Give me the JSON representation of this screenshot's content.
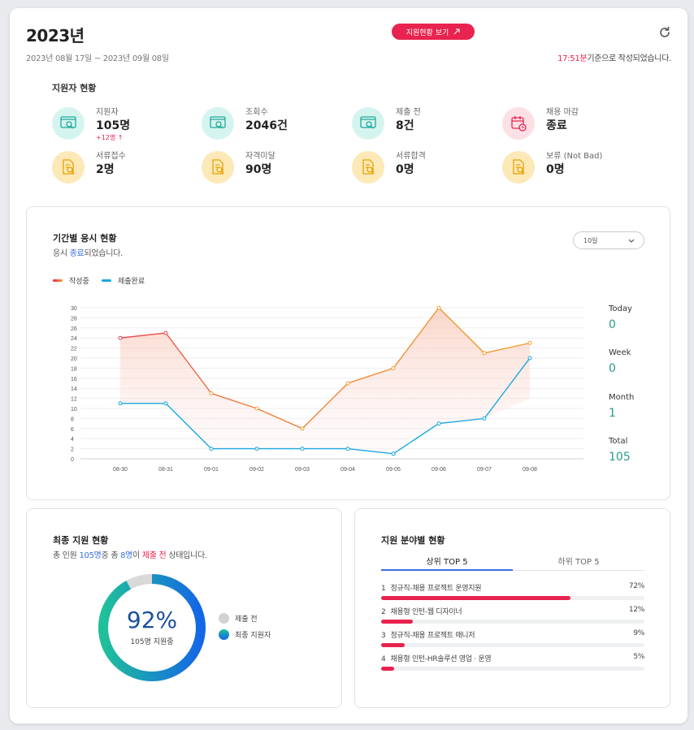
{
  "header": {
    "title": "2023년",
    "date_range": "2023년 08월 17일 ~ 2023년 09월 08일",
    "view_button": "지원현황 보기",
    "stamp_time": "17:51분",
    "stamp_suffix": "기준으로 작성되었습니다."
  },
  "applicants": {
    "section_title": "지원자 현황",
    "stats": [
      {
        "label": "지원자",
        "value": "105명",
        "delta": "+12명 ↑",
        "icon": "monitor-search-icon",
        "color": "teal"
      },
      {
        "label": "조회수",
        "value": "2046건",
        "icon": "monitor-search-icon",
        "color": "teal"
      },
      {
        "label": "제출 전",
        "value": "8건",
        "icon": "monitor-search-icon",
        "color": "teal"
      },
      {
        "label": "채용 마감",
        "value": "종료",
        "icon": "calendar-clock-icon",
        "color": "pink"
      },
      {
        "label": "서류접수",
        "value": "2명",
        "icon": "document-search-icon",
        "color": "yellow"
      },
      {
        "label": "자격미달",
        "value": "90명",
        "icon": "document-search-icon",
        "color": "yellow"
      },
      {
        "label": "서류합격",
        "value": "0명",
        "icon": "document-search-icon",
        "color": "yellow"
      },
      {
        "label": "보류 (Not Bad)",
        "value": "0명",
        "icon": "document-search-icon",
        "color": "yellow"
      }
    ]
  },
  "period": {
    "title": "기간별 응시 현황",
    "sub_prefix": "응시 ",
    "sub_highlight": "종료",
    "sub_suffix": "되었습니다.",
    "select_value": "10일",
    "side_stats": [
      {
        "label": "Today",
        "value": "0"
      },
      {
        "label": "Week",
        "value": "0"
      },
      {
        "label": "Month",
        "value": "1"
      },
      {
        "label": "Total",
        "value": "105"
      }
    ]
  },
  "chart_data": {
    "type": "line",
    "x": [
      "08-30",
      "08-31",
      "09-01",
      "09-02",
      "09-03",
      "09-04",
      "09-05",
      "09-06",
      "09-07",
      "09-08"
    ],
    "series": [
      {
        "name": "작성중",
        "values": [
          24,
          25,
          13,
          10,
          6,
          15,
          18,
          30,
          21,
          23
        ],
        "color": "#f0a030"
      },
      {
        "name": "제출완료",
        "values": [
          11,
          11,
          2,
          2,
          2,
          2,
          1,
          7,
          8,
          20
        ],
        "color": "#1aa7e0"
      }
    ],
    "yticks": [
      0,
      2,
      4,
      6,
      8,
      10,
      12,
      14,
      16,
      18,
      20,
      22,
      24,
      26,
      28,
      30
    ],
    "ylim": [
      0,
      30
    ],
    "grid": true,
    "legend": "top-left"
  },
  "final": {
    "title": "최종 지원 현황",
    "s1": "총 인원 ",
    "s2": "105명",
    "s3": "중 총 ",
    "s4": "8명",
    "s5": "이 ",
    "s6": "제출 전",
    "s7": " 상태입니다.",
    "percent": "92%",
    "center_sub": "105명 지원중",
    "ratio": 0.92,
    "legend_before": "제출 전",
    "legend_final": "최종 지원자"
  },
  "field": {
    "title": "지원 분야별 현황",
    "tab_top": "상위 TOP 5",
    "tab_bottom": "하위 TOP 5",
    "items": [
      {
        "rank": "1",
        "name": "정규직-채용 프로젝트 운영지원",
        "percent": "72%",
        "value": 72
      },
      {
        "rank": "2",
        "name": "채용형 인턴-웹 디자이너",
        "percent": "12%",
        "value": 12
      },
      {
        "rank": "3",
        "name": "정규직-채용 프로젝트 매니저",
        "percent": "9%",
        "value": 9
      },
      {
        "rank": "4",
        "name": "채용형 인턴-HR솔루션 영업 · 운영",
        "percent": "5%",
        "value": 5
      }
    ]
  }
}
